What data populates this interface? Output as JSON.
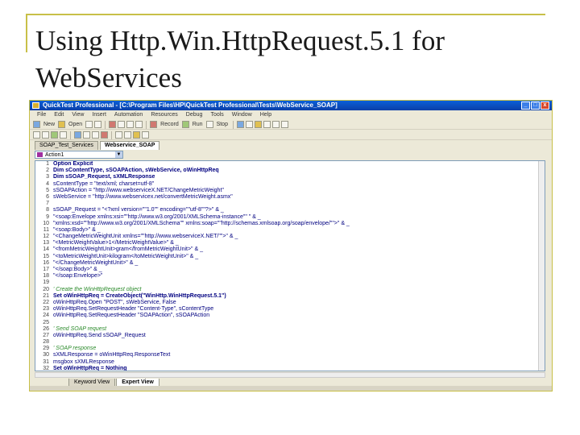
{
  "slide": {
    "title": "Using Http.Win.HttpRequest.5.1 for WebServices"
  },
  "window": {
    "title": "QuickTest Professional - [C:\\Program Files\\HP\\QuickTest Professional\\Tests\\WebService_SOAP]",
    "minimize": "_",
    "maximize": "□",
    "close": "x"
  },
  "menu": [
    "File",
    "Edit",
    "View",
    "Insert",
    "Automation",
    "Resources",
    "Debug",
    "Tools",
    "Window",
    "Help"
  ],
  "toolbar1": {
    "new_label": "New",
    "open_label": "Open",
    "record_label": "Record",
    "run_label": "Run",
    "stop_label": "Stop"
  },
  "tabs": [
    "SOAP_Test_Services",
    "Webservice_SOAP"
  ],
  "action": {
    "selected": "Action1",
    "arrow": "▼"
  },
  "code": [
    {
      "n": "1",
      "t": "Option Explicit",
      "style": "kw"
    },
    {
      "n": "2",
      "t": "Dim sContentType, sSOAPAction, sWebService, oWinHttpReq",
      "style": "kw"
    },
    {
      "n": "3",
      "t": "Dim sSOAP_Request, sXMLResponse",
      "style": "kw"
    },
    {
      "n": "4",
      "t": "sContentType = \"text/xml; charset=utf-8\"",
      "style": ""
    },
    {
      "n": "5",
      "t": "sSOAPAction = \"http://www.webserviceX.NET/ChangeMetricWeight\"",
      "style": ""
    },
    {
      "n": "6",
      "t": "sWebService = \"http://www.webservicex.net/convertMetricWeight.asmx\"",
      "style": ""
    },
    {
      "n": "7",
      "t": "",
      "style": ""
    },
    {
      "n": "8",
      "t": "sSOAP_Request = \"<?xml version=\"\"1.0\"\" encoding=\"\"utf-8\"\"?>\" & _",
      "style": ""
    },
    {
      "n": "9",
      "t": "\"<soap:Envelope xmlns:xsi=\"\"http://www.w3.org/2001/XMLSchema-instance\"\" \" & _",
      "style": ""
    },
    {
      "n": "10",
      "t": "\"xmlns:xsd=\"\"http://www.w3.org/2001/XMLSchema\"\" xmlns:soap=\"\"http://schemas.xmlsoap.org/soap/envelope/\"\">\" & _",
      "style": ""
    },
    {
      "n": "11",
      "t": "\"<soap:Body>\" & _",
      "style": ""
    },
    {
      "n": "12",
      "t": "\"<ChangeMetricWeightUnit xmlns=\"\"http://www.webserviceX.NET/\"\">\" & _",
      "style": ""
    },
    {
      "n": "13",
      "t": "\"<MetricWeightValue>1</MetricWeightValue>\" & _",
      "style": ""
    },
    {
      "n": "14",
      "t": "\"<fromMetricWeightUnit>gram</fromMetricWeightUnit>\" & _",
      "style": ""
    },
    {
      "n": "15",
      "t": "\"<toMetricWeightUnit>kilogram</toMetricWeightUnit>\" & _",
      "style": ""
    },
    {
      "n": "16",
      "t": "\"</ChangeMetricWeightUnit>\" & _",
      "style": ""
    },
    {
      "n": "17",
      "t": "\"</soap:Body>\" & _",
      "style": ""
    },
    {
      "n": "18",
      "t": "\"</soap:Envelope>\"",
      "style": ""
    },
    {
      "n": "19",
      "t": "",
      "style": ""
    },
    {
      "n": "20",
      "t": "' Create the WinHttpRequest object",
      "style": "cm"
    },
    {
      "n": "21",
      "t": "Set oWinHttpReq = CreateObject(\"WinHttp.WinHttpRequest.5.1\")",
      "style": "kw"
    },
    {
      "n": "22",
      "t": "oWinHttpReq.Open \"POST\", sWebService, False",
      "style": ""
    },
    {
      "n": "23",
      "t": "oWinHttpReq.SetRequestHeader \"Content-Type\", sContentType",
      "style": ""
    },
    {
      "n": "24",
      "t": "oWinHttpReq.SetRequestHeader \"SOAPAction\", sSOAPAction",
      "style": ""
    },
    {
      "n": "25",
      "t": "",
      "style": ""
    },
    {
      "n": "26",
      "t": "' Send SOAP request",
      "style": "cm"
    },
    {
      "n": "27",
      "t": "oWinHttpReq.Send sSOAP_Request",
      "style": ""
    },
    {
      "n": "28",
      "t": "",
      "style": ""
    },
    {
      "n": "29",
      "t": "' SOAP response",
      "style": "cm"
    },
    {
      "n": "30",
      "t": "sXMLResponse = oWinHttpReq.ResponseText",
      "style": ""
    },
    {
      "n": "31",
      "t": "msgbox sXMLResponse",
      "style": ""
    },
    {
      "n": "32",
      "t": "Set oWinHttpReq = Nothing",
      "style": "kw"
    }
  ],
  "view_tabs": [
    "Keyword View",
    "Expert View"
  ],
  "colors": {
    "accent_line": "#c8c048",
    "titlebar": "#0a5fd8",
    "code_text": "#000080",
    "comment": "#2a8a2a"
  }
}
